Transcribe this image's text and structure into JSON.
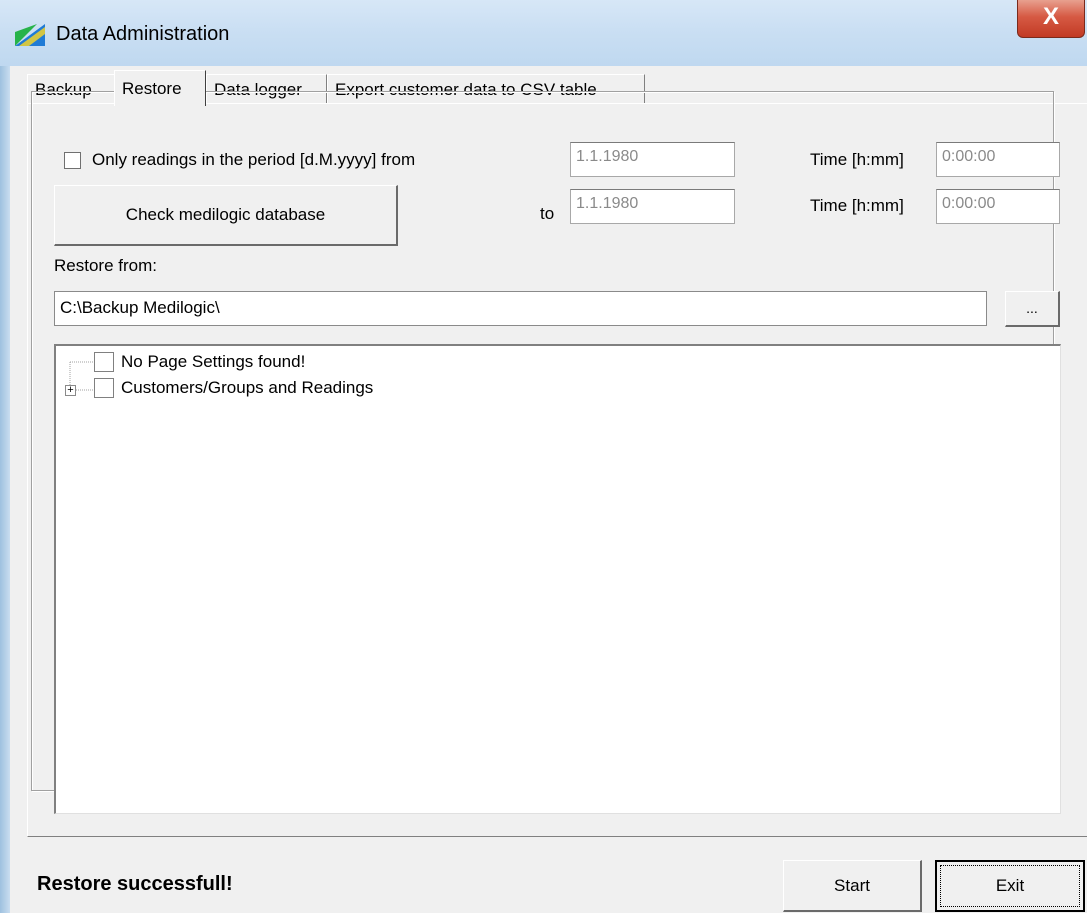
{
  "window": {
    "title": "Data Administration",
    "close_label": "X"
  },
  "tabs": [
    {
      "label": "Backup",
      "active": false
    },
    {
      "label": "Restore",
      "active": true
    },
    {
      "label": "Data logger",
      "active": false
    },
    {
      "label": "Export customer data to CSV table",
      "active": false
    }
  ],
  "period": {
    "checkbox_label": "Only readings in the period [d.M.yyyy] from",
    "checked": false,
    "from_date": "1.1.1980",
    "to_label": "to",
    "to_date": "1.1.1980",
    "time_label": "Time [h:mm]",
    "from_time": "0:00:00",
    "to_time": "0:00:00"
  },
  "check_button_label": "Check medilogic database",
  "restore_from": {
    "label": "Restore from:",
    "path": "C:\\Backup Medilogic\\",
    "browse_label": "..."
  },
  "tree": [
    {
      "label": "No Page Settings found!",
      "checked": false,
      "expandable": false
    },
    {
      "label": "Customers/Groups and Readings",
      "checked": false,
      "expandable": true,
      "expander_symbol": "+"
    }
  ],
  "status_text": "Restore successfull!",
  "start_label": "Start",
  "exit_label": "Exit",
  "colors": {
    "titlebar": "#cadff3",
    "close": "#c23a24",
    "panel": "#f0f0f0"
  }
}
